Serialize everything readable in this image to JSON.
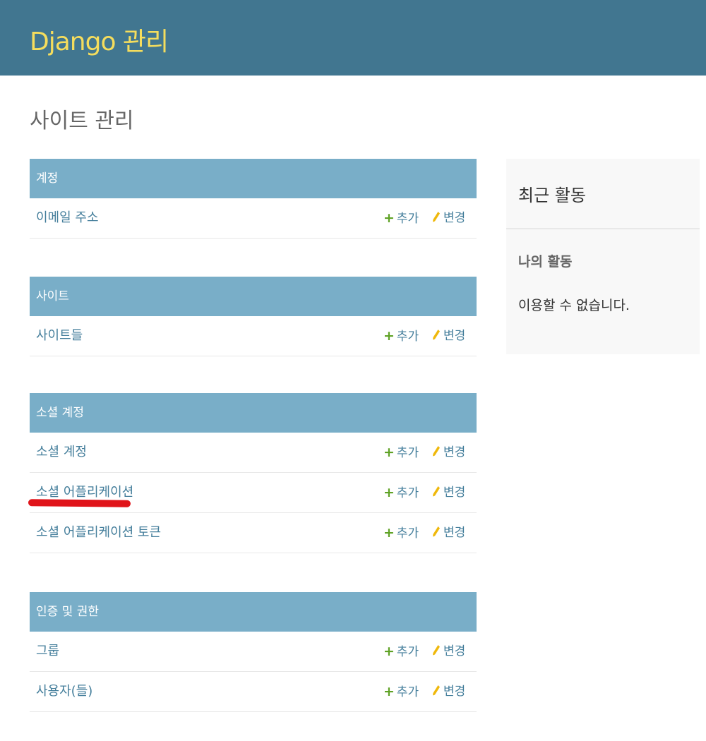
{
  "header": {
    "brand": "Django 관리"
  },
  "page_title": "사이트 관리",
  "modules": [
    {
      "caption": "계정",
      "models": [
        {
          "name": "이메일 주소",
          "add": "추가",
          "change": "변경"
        }
      ]
    },
    {
      "caption": "사이트",
      "models": [
        {
          "name": "사이트들",
          "add": "추가",
          "change": "변경"
        }
      ]
    },
    {
      "caption": "소셜 계정",
      "models": [
        {
          "name": "소셜 계정",
          "add": "추가",
          "change": "변경"
        },
        {
          "name": "소셜 어플리케이션",
          "add": "추가",
          "change": "변경"
        },
        {
          "name": "소셜 어플리케이션 토큰",
          "add": "추가",
          "change": "변경"
        }
      ]
    },
    {
      "caption": "인증 및 권한",
      "models": [
        {
          "name": "그룹",
          "add": "추가",
          "change": "변경"
        },
        {
          "name": "사용자(들)",
          "add": "추가",
          "change": "변경"
        }
      ]
    }
  ],
  "recent_actions": {
    "title": "최근 활동",
    "my_actions": "나의 활동",
    "none_available": "이용할 수 없습니다."
  },
  "colors": {
    "header_bg": "#417690",
    "brand": "#f5dd5d",
    "caption_bg": "#79aec8",
    "link": "#447e9b",
    "add_icon": "#5fa225",
    "change_icon": "#efb80b",
    "annotation_underline": "#e0141a"
  },
  "icons": {
    "add": "plus-icon",
    "change": "pencil-icon"
  }
}
